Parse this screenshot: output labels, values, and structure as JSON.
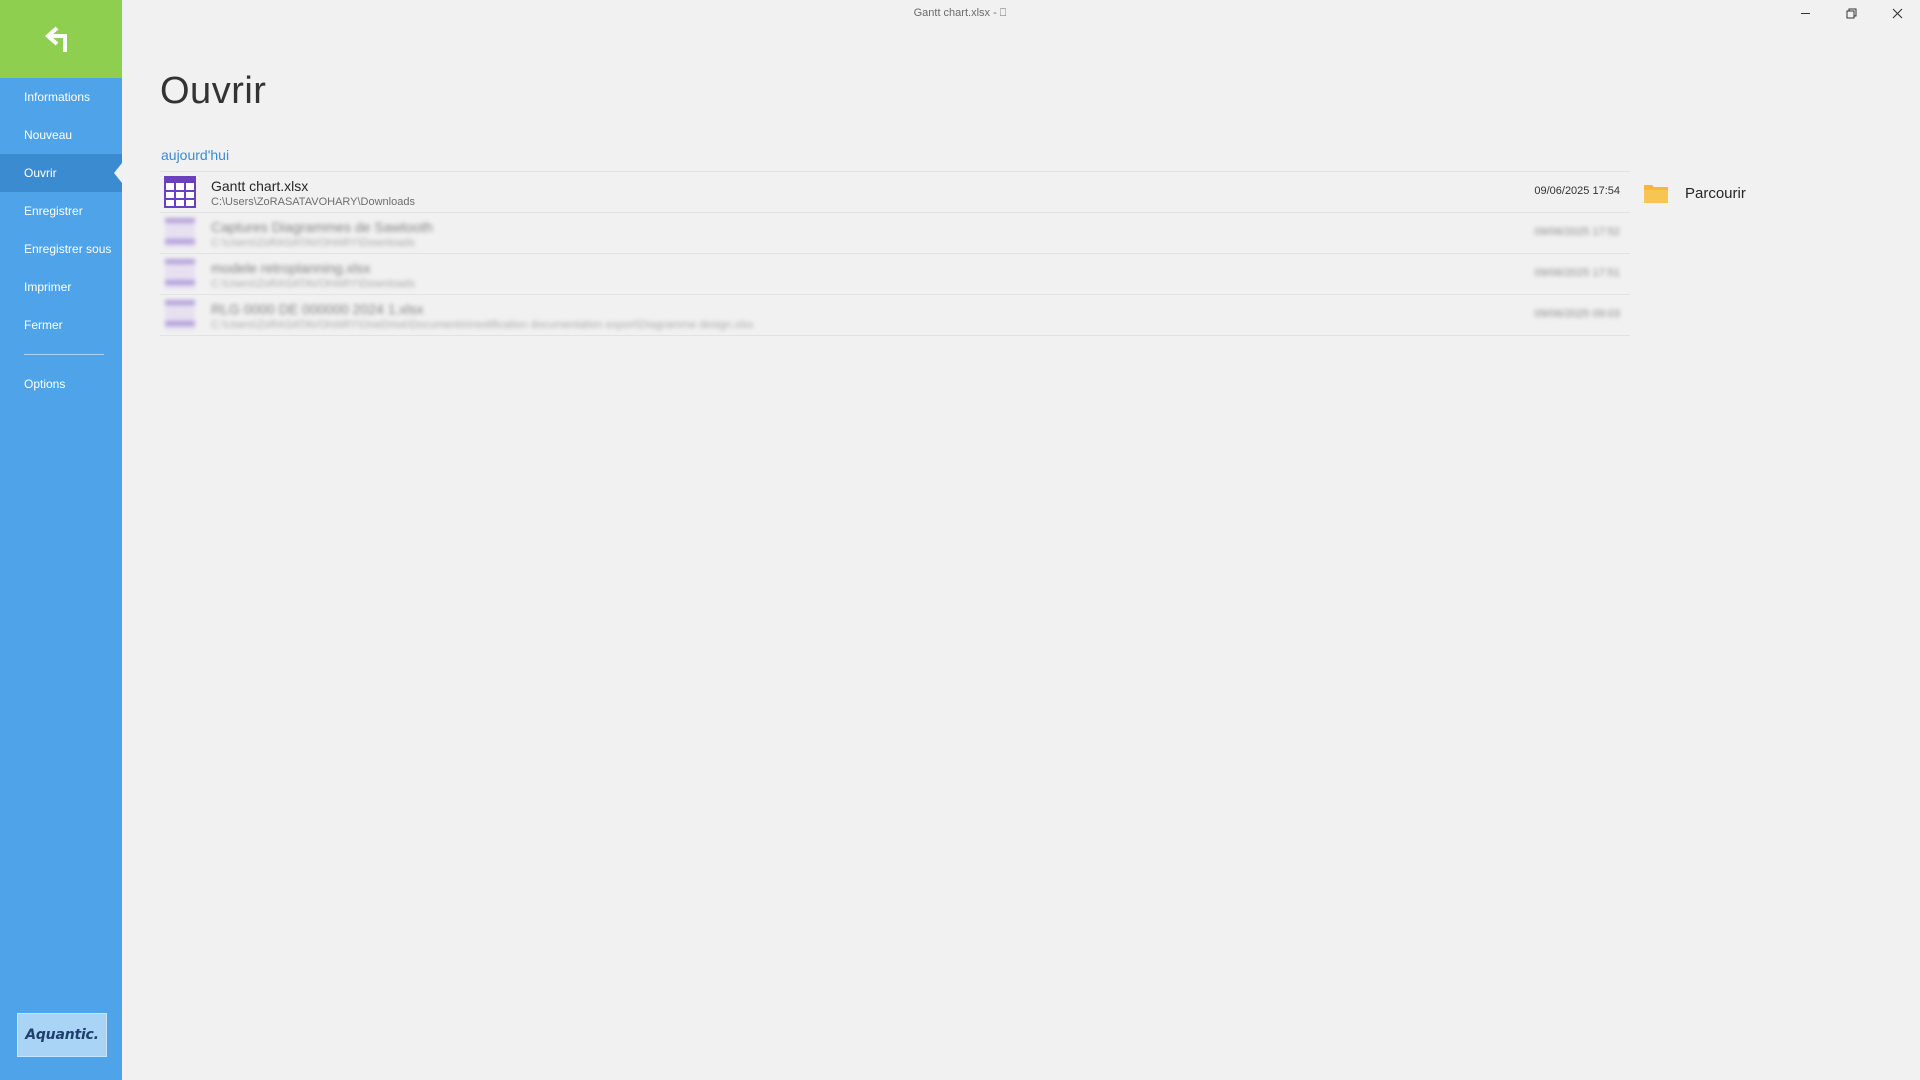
{
  "window": {
    "title": "Gantt chart.xlsx - ⎕",
    "controls": [
      "minimize",
      "restore",
      "close"
    ]
  },
  "sidebar": {
    "back_icon": "back-arrow-icon",
    "items": [
      {
        "label": "Informations"
      },
      {
        "label": "Nouveau"
      },
      {
        "label": "Ouvrir",
        "active": true
      },
      {
        "label": "Enregistrer"
      },
      {
        "label": "Enregistrer sous"
      },
      {
        "label": "Imprimer"
      },
      {
        "label": "Fermer"
      }
    ],
    "options_label": "Options",
    "brand": "Aquantic.",
    "colors": {
      "background": "#4fa3e8",
      "active": "#3b8bd0",
      "back_tile": "#8ecf4f"
    }
  },
  "main": {
    "title": "Ouvrir",
    "group_label": "aujourd'hui",
    "files": [
      {
        "name": "Gantt chart.xlsx",
        "path": "C:\\Users\\ZoRASATAVOHARY\\Downloads",
        "date": "09/06/2025 17:54",
        "blurred": false
      },
      {
        "name": "Captures Diagrammes de Sawtooth",
        "path": "C:\\Users\\ZoRASATAVOHARY\\Downloads",
        "date": "09/06/2025 17:52",
        "blurred": true
      },
      {
        "name": "modele retroplanning.xlsx",
        "path": "C:\\Users\\ZoRASATAVOHARY\\Downloads",
        "date": "09/06/2025 17:51",
        "blurred": true
      },
      {
        "name": "RLG 0000 DE 000000 2024 1.xlsx",
        "path": "C:\\Users\\ZoRASATAVOHARY\\OneDrive\\Documents\\modification documentation export\\Diagramme design.xlsx",
        "date": "09/06/2025 09:03",
        "blurred": true
      }
    ],
    "browse_label": "Parcourir",
    "browse_icon": "folder-icon"
  }
}
